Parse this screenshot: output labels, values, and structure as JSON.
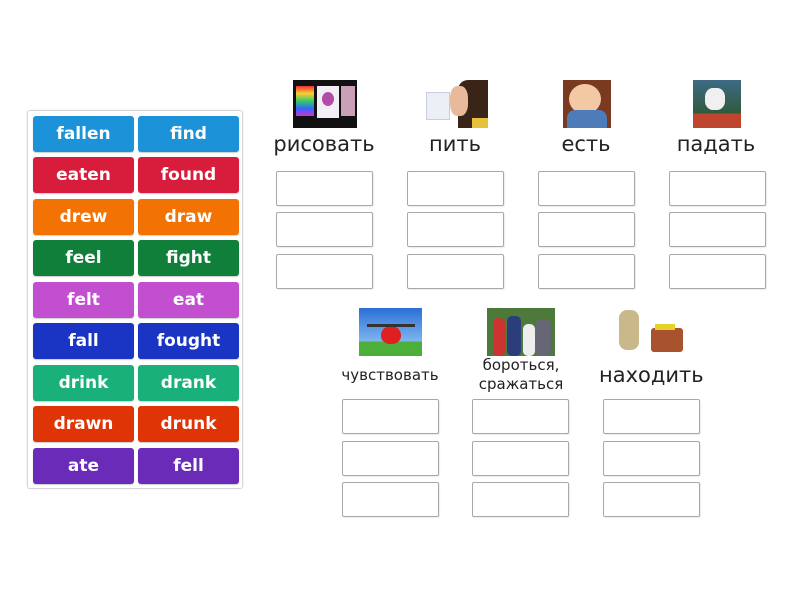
{
  "word_bank": {
    "tiles": [
      {
        "label": "fallen",
        "color": "#1c93d9"
      },
      {
        "label": "find",
        "color": "#1c93d9"
      },
      {
        "label": "eaten",
        "color": "#d81d3c"
      },
      {
        "label": "found",
        "color": "#d81d3c"
      },
      {
        "label": "drew",
        "color": "#f27304"
      },
      {
        "label": "draw",
        "color": "#f27304"
      },
      {
        "label": "feel",
        "color": "#0f7f3a"
      },
      {
        "label": "fight",
        "color": "#0f7f3a"
      },
      {
        "label": "felt",
        "color": "#c24ed0"
      },
      {
        "label": "eat",
        "color": "#c24ed0"
      },
      {
        "label": "fall",
        "color": "#1a34c4"
      },
      {
        "label": "fought",
        "color": "#1a34c4"
      },
      {
        "label": "drink",
        "color": "#1ab07a"
      },
      {
        "label": "drank",
        "color": "#1ab07a"
      },
      {
        "label": "drawn",
        "color": "#df3406"
      },
      {
        "label": "drunk",
        "color": "#df3406"
      },
      {
        "label": "ate",
        "color": "#6a2bb8"
      },
      {
        "label": "fell",
        "color": "#6a2bb8"
      }
    ]
  },
  "groups": [
    {
      "label": "рисовать",
      "image": "painting-image"
    },
    {
      "label": "пить",
      "image": "drinking-woman-image"
    },
    {
      "label": "есть",
      "image": "eating-baby-image"
    },
    {
      "label": "падать",
      "image": "falling-man-image"
    },
    {
      "label": "чувствовать",
      "image": "heart-weightlifting-image"
    },
    {
      "label": "бороться, сражаться",
      "image": "fighting-people-image"
    },
    {
      "label": "находить",
      "image": "treasure-finder-image"
    }
  ]
}
